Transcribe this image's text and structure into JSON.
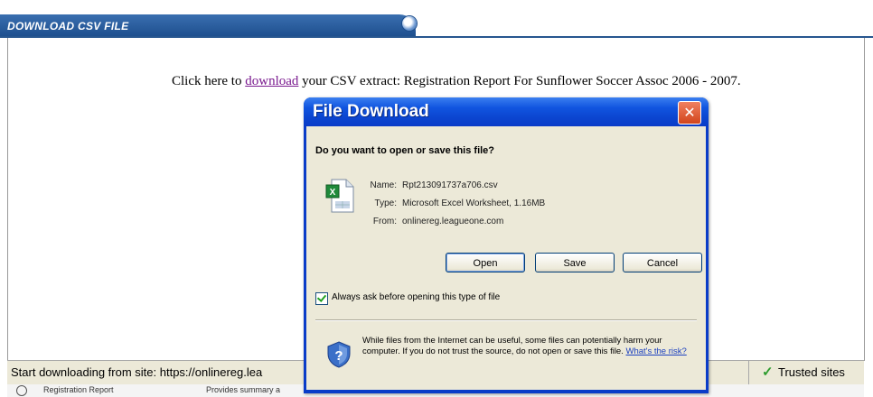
{
  "header": {
    "tab_title": "DOWNLOAD CSV FILE"
  },
  "content": {
    "prefix": "Click here to ",
    "link_text": "download",
    "suffix": " your CSV extract: Registration Report For Sunflower Soccer Assoc 2006 - 2007."
  },
  "statusbar": {
    "text": "Start downloading from site: https://onlinereg.lea",
    "zone_label": "Trusted sites"
  },
  "bottom_strip": {
    "item1": "Registration Report",
    "item2": "Provides summary a"
  },
  "dialog": {
    "title": "File Download",
    "close_symbol": "✕",
    "question": "Do you want to open or save this file?",
    "file_icon": "excel-file-icon",
    "fields": {
      "name_label": "Name:",
      "name_value": "Rpt213091737a706.csv",
      "type_label": "Type:",
      "type_value": "Microsoft Excel Worksheet, 1.16MB",
      "from_label": "From:",
      "from_value": "onlinereg.leagueone.com"
    },
    "buttons": {
      "open": "Open",
      "save": "Save",
      "cancel": "Cancel"
    },
    "checkbox_label": "Always ask before opening this type of file",
    "checkbox_checked": true,
    "warning_text": "While files from the Internet can be useful, some files can potentially harm your computer. If you do not trust the source, do not open or save this file. ",
    "risk_link": "What's the risk?"
  },
  "colors": {
    "tab_blue": "#1c4d8c",
    "dialog_title_blue": "#0a3cc8",
    "dialog_body": "#ece9d8",
    "link_purple": "#7a1a8f",
    "trusted_check": "#2e9c2e"
  }
}
